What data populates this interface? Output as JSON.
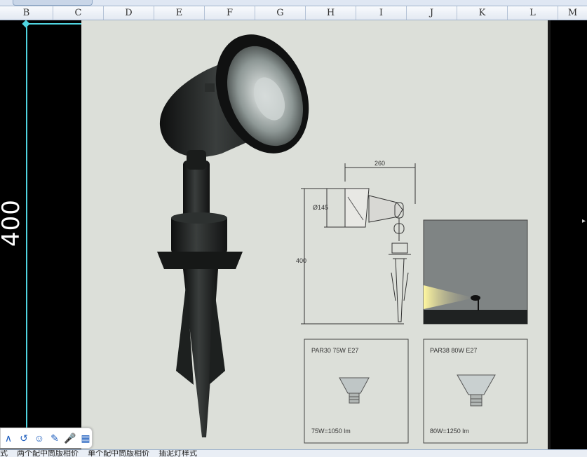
{
  "columns": [
    "B",
    "C",
    "D",
    "E",
    "F",
    "G",
    "H",
    "I",
    "J",
    "K",
    "L",
    "M"
  ],
  "dimension_label": "400",
  "diagram": {
    "width_label": "260",
    "diameter_label": "Ø145",
    "height_label": "400"
  },
  "lamp_box_1": {
    "title": "PAR30 75W E27",
    "output": "75W=1050 lm"
  },
  "lamp_box_2": {
    "title": "PAR38 80W E27",
    "output": "80W=1250 lm"
  },
  "bottom_tabs": [
    "式",
    "两个配中筒版相价",
    "单个配中筒版相价",
    "插泥灯样式"
  ],
  "toolbar_icons": [
    "text-a-icon",
    "rotate-icon",
    "emoji-icon",
    "pen-icon",
    "microphone-icon",
    "grid-icon"
  ],
  "colors": {
    "dimension_line": "#4fd4e0",
    "panel_bg": "#dcdfd9",
    "lamp_body": "#1e2120"
  }
}
